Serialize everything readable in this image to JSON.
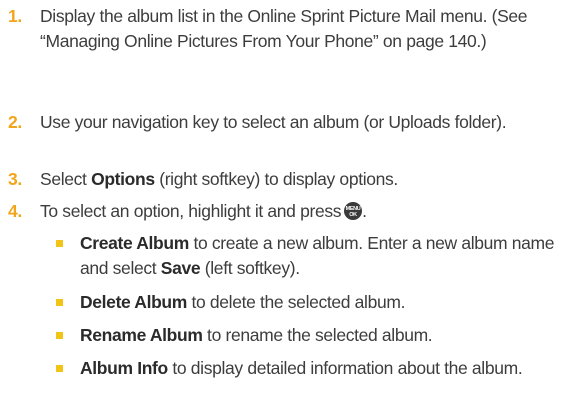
{
  "steps": [
    {
      "number": "1.",
      "text": "Display the album list in the Online Sprint Picture Mail menu. (See “Managing Online Pictures From Your Phone” on page 140.)"
    },
    {
      "number": "2.",
      "text": "Use your navigation key to select an album (or Uploads folder)."
    },
    {
      "number": "3.",
      "bold": "Options",
      "text_before": "Select ",
      "text_after": " (right softkey) to display options."
    },
    {
      "number": "4.",
      "text": "To select an option, highlight it and press",
      "key_icon": "menu-ok-key-icon",
      "text_after": "."
    }
  ],
  "options": [
    {
      "title": "Create Album",
      "text_before": " to create a new album. Enter a new album name and select ",
      "bold2": "Save",
      "text_after": " (left softkey)."
    },
    {
      "title": "Delete Album",
      "text": " to delete the selected album."
    },
    {
      "title": "Rename Album",
      "text": " to rename the selected album."
    },
    {
      "title": "Album Info",
      "text": " to display detailed information about the album."
    }
  ],
  "colors": {
    "number": "#f2a51a",
    "bullet": "#f2c417",
    "text": "#3d3d3d"
  }
}
